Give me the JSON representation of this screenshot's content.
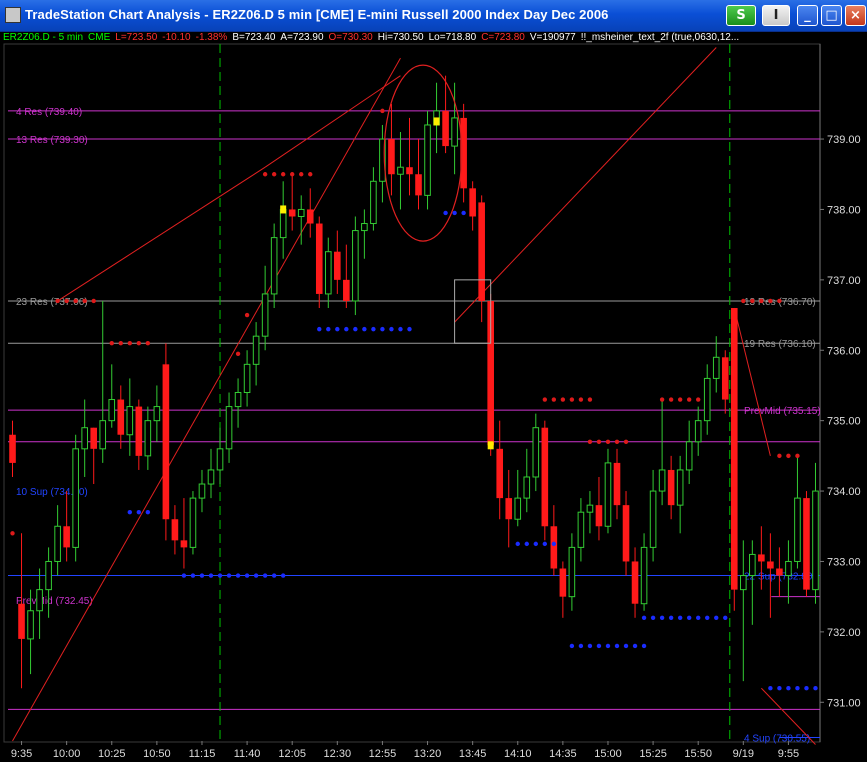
{
  "window": {
    "title": "TradeStation Chart Analysis - ER2Z06.D  5 min  [CME] E-mini Russell 2000 Index Day Dec 2006",
    "buttons": {
      "s_label": "S",
      "menu_label": "I",
      "minimize": "_",
      "maximize": "□",
      "close": "×"
    }
  },
  "status_bar": [
    {
      "text": "ER2Z06.D - 5 min",
      "color": "#00ff00"
    },
    {
      "text": "CME",
      "color": "#00ff00"
    },
    {
      "text": "L=723.50",
      "color": "#ff3030"
    },
    {
      "text": "-10.10",
      "color": "#ff3030"
    },
    {
      "text": "-1.38%",
      "color": "#ff3030"
    },
    {
      "text": "B=723.40",
      "color": "#ffffff"
    },
    {
      "text": "A=723.90",
      "color": "#ffffff"
    },
    {
      "text": "O=730.30",
      "color": "#ff3030"
    },
    {
      "text": "Hi=730.50",
      "color": "#ffffff"
    },
    {
      "text": "Lo=718.80",
      "color": "#ffffff"
    },
    {
      "text": "C=723.80",
      "color": "#ff3030"
    },
    {
      "text": "V=190977",
      "color": "#ffffff"
    },
    {
      "text": "!!_msheiner_text_2f (true,0630,12...",
      "color": "#ffffff"
    }
  ],
  "chart_data": {
    "type": "candlestick",
    "title": "ER2Z06.D 5 min",
    "ylim": [
      730.45,
      740.35
    ],
    "y_ticks": [
      731,
      732,
      733,
      734,
      735,
      736,
      737,
      738,
      739
    ],
    "y_tick_labels": [
      "731.00",
      "732.00",
      "733.00",
      "734.00",
      "735.00",
      "736.00",
      "737.00",
      "738.00",
      "739.00"
    ],
    "x_tick_labels": [
      {
        "index": 1,
        "label": "9:35"
      },
      {
        "index": 6,
        "label": "10:00"
      },
      {
        "index": 11,
        "label": "10:25"
      },
      {
        "index": 16,
        "label": "10:50"
      },
      {
        "index": 21,
        "label": "11:15"
      },
      {
        "index": 26,
        "label": "11:40"
      },
      {
        "index": 31,
        "label": "12:05"
      },
      {
        "index": 36,
        "label": "12:30"
      },
      {
        "index": 41,
        "label": "12:55"
      },
      {
        "index": 46,
        "label": "13:20"
      },
      {
        "index": 51,
        "label": "13:45"
      },
      {
        "index": 56,
        "label": "14:10"
      },
      {
        "index": 61,
        "label": "14:35"
      },
      {
        "index": 66,
        "label": "15:00"
      },
      {
        "index": 71,
        "label": "15:25"
      },
      {
        "index": 76,
        "label": "15:50"
      },
      {
        "index": 81,
        "label": "9/19"
      },
      {
        "index": 86,
        "label": "9:55"
      }
    ],
    "levels": [
      {
        "label": "4 Res (739.40)",
        "y": 739.4,
        "color": "#cc33cc",
        "dx": 0,
        "x1": 0,
        "x2": 1
      },
      {
        "label": "13 Res (739.30)",
        "y": 739.0,
        "color": "#cc33cc",
        "dx": 0,
        "x1": 0,
        "x2": 1
      },
      {
        "label": "23 Res (737.00)",
        "y": 736.7,
        "color": "#9a9a9a",
        "dx": 0,
        "x1": 0,
        "x2": 1
      },
      {
        "label": "13 Res (736.70)",
        "y": 736.7,
        "color": "#9a9a9a",
        "dx": 1,
        "x1": 0,
        "x2": 1
      },
      {
        "label": "19 Res (736.10)",
        "y": 736.1,
        "color": "#9a9a9a",
        "dx": 1,
        "x1": 0,
        "x2": 1
      },
      {
        "label": "PrevMid (735.15)",
        "y": 735.15,
        "color": "#cc33cc",
        "dx": 1,
        "x1": 0,
        "x2": 1
      },
      {
        "label": "",
        "y": 734.7,
        "color": "#cc33cc",
        "dx": 0,
        "x1": 0,
        "x2": 1
      },
      {
        "label": "10 Sup (734.00)",
        "y": 734.0,
        "color": "#2244ff",
        "dx": 0,
        "x1": 0,
        "x2": 0
      },
      {
        "label": "22 Sup (732.80)",
        "y": 732.8,
        "color": "#2244ff",
        "dx": 1,
        "x1": 0,
        "x2": 1
      },
      {
        "label": "PrevMid (732.45)",
        "y": 732.45,
        "color": "#cc33cc",
        "dx": 0,
        "x1": 0,
        "x2": 0
      },
      {
        "label": "",
        "y": 732.5,
        "color": "#cc33cc",
        "dx": 0,
        "x1": 0.94,
        "x2": 1
      },
      {
        "label": "",
        "y": 730.9,
        "color": "#cc33cc",
        "dx": 0,
        "x1": 0,
        "x2": 1
      },
      {
        "label": "4 Sup (730.55)",
        "y": 730.5,
        "color": "#2244ff",
        "dx": 1,
        "x1": 0.95,
        "x2": 1
      }
    ],
    "day_separator_index": 80,
    "session_start_index": 23,
    "resistance_dots": [
      {
        "start": 0,
        "end": 0,
        "y": 733.4
      },
      {
        "start": 5,
        "end": 9,
        "y": 736.7
      },
      {
        "start": 11,
        "end": 15,
        "y": 736.1
      },
      {
        "start": 25,
        "end": 25,
        "y": 735.95
      },
      {
        "start": 26,
        "end": 26,
        "y": 736.5
      },
      {
        "start": 28,
        "end": 33,
        "y": 738.5
      },
      {
        "start": 41,
        "end": 41,
        "y": 739.4
      },
      {
        "start": 59,
        "end": 64,
        "y": 735.3
      },
      {
        "start": 64,
        "end": 68,
        "y": 734.7
      },
      {
        "start": 72,
        "end": 76,
        "y": 735.3
      },
      {
        "start": 81,
        "end": 85,
        "y": 736.7
      },
      {
        "start": 85,
        "end": 87,
        "y": 734.5
      }
    ],
    "support_dots": [
      {
        "start": 13,
        "end": 15,
        "y": 733.7
      },
      {
        "start": 19,
        "end": 30,
        "y": 732.8
      },
      {
        "start": 34,
        "end": 44,
        "y": 736.3
      },
      {
        "start": 48,
        "end": 50,
        "y": 737.95
      },
      {
        "start": 56,
        "end": 60,
        "y": 733.25
      },
      {
        "start": 62,
        "end": 70,
        "y": 731.8
      },
      {
        "start": 70,
        "end": 79,
        "y": 732.2
      },
      {
        "start": 84,
        "end": 89,
        "y": 731.2
      }
    ],
    "markers": [
      {
        "index": 30,
        "y": 738.0,
        "color": "#ffee00"
      },
      {
        "index": 47,
        "y": 739.25,
        "color": "#ffee00"
      },
      {
        "index": 53,
        "y": 734.65,
        "color": "#ffee00"
      }
    ],
    "candles": [
      {
        "o": 734.8,
        "h": 735.0,
        "l": 734.2,
        "c": 734.4
      },
      {
        "o": 732.4,
        "h": 733.4,
        "l": 731.2,
        "c": 731.9
      },
      {
        "o": 731.9,
        "h": 732.6,
        "l": 731.4,
        "c": 732.3
      },
      {
        "o": 732.3,
        "h": 732.9,
        "l": 731.9,
        "c": 732.6
      },
      {
        "o": 732.6,
        "h": 733.2,
        "l": 732.2,
        "c": 733.0
      },
      {
        "o": 733.0,
        "h": 733.8,
        "l": 732.8,
        "c": 733.5
      },
      {
        "o": 733.5,
        "h": 734.0,
        "l": 733.0,
        "c": 733.2
      },
      {
        "o": 733.2,
        "h": 734.8,
        "l": 733.0,
        "c": 734.6
      },
      {
        "o": 734.6,
        "h": 735.3,
        "l": 734.2,
        "c": 734.9
      },
      {
        "o": 734.9,
        "h": 734.9,
        "l": 734.1,
        "c": 734.6
      },
      {
        "o": 734.6,
        "h": 736.7,
        "l": 734.4,
        "c": 735.0
      },
      {
        "o": 735.0,
        "h": 735.8,
        "l": 734.9,
        "c": 735.3
      },
      {
        "o": 735.3,
        "h": 735.5,
        "l": 734.6,
        "c": 734.8
      },
      {
        "o": 734.8,
        "h": 735.6,
        "l": 734.5,
        "c": 735.2
      },
      {
        "o": 735.2,
        "h": 735.3,
        "l": 734.3,
        "c": 734.5
      },
      {
        "o": 734.5,
        "h": 735.2,
        "l": 734.3,
        "c": 735.0
      },
      {
        "o": 735.0,
        "h": 735.5,
        "l": 734.7,
        "c": 735.2
      },
      {
        "o": 735.8,
        "h": 736.1,
        "l": 733.3,
        "c": 733.6
      },
      {
        "o": 733.6,
        "h": 733.8,
        "l": 733.1,
        "c": 733.3
      },
      {
        "o": 733.3,
        "h": 733.9,
        "l": 732.9,
        "c": 733.2
      },
      {
        "o": 733.2,
        "h": 734.0,
        "l": 733.1,
        "c": 733.9
      },
      {
        "o": 733.9,
        "h": 734.3,
        "l": 733.7,
        "c": 734.1
      },
      {
        "o": 734.1,
        "h": 734.6,
        "l": 733.9,
        "c": 734.3
      },
      {
        "o": 734.3,
        "h": 734.9,
        "l": 734.1,
        "c": 734.6
      },
      {
        "o": 734.6,
        "h": 735.4,
        "l": 734.4,
        "c": 735.2
      },
      {
        "o": 735.2,
        "h": 735.6,
        "l": 734.9,
        "c": 735.4
      },
      {
        "o": 735.4,
        "h": 736.0,
        "l": 735.2,
        "c": 735.8
      },
      {
        "o": 735.8,
        "h": 736.4,
        "l": 735.5,
        "c": 736.2
      },
      {
        "o": 736.2,
        "h": 737.2,
        "l": 736.0,
        "c": 736.8
      },
      {
        "o": 736.8,
        "h": 737.8,
        "l": 736.6,
        "c": 737.6
      },
      {
        "o": 737.6,
        "h": 738.4,
        "l": 737.3,
        "c": 738.0
      },
      {
        "o": 738.0,
        "h": 738.5,
        "l": 737.7,
        "c": 737.9
      },
      {
        "o": 737.9,
        "h": 738.2,
        "l": 737.5,
        "c": 738.0
      },
      {
        "o": 738.0,
        "h": 738.3,
        "l": 737.6,
        "c": 737.8
      },
      {
        "o": 737.8,
        "h": 737.9,
        "l": 736.6,
        "c": 736.8
      },
      {
        "o": 736.8,
        "h": 737.6,
        "l": 736.6,
        "c": 737.4
      },
      {
        "o": 737.4,
        "h": 737.7,
        "l": 736.8,
        "c": 737.0
      },
      {
        "o": 737.0,
        "h": 737.5,
        "l": 736.6,
        "c": 736.7
      },
      {
        "o": 736.7,
        "h": 737.9,
        "l": 736.5,
        "c": 737.7
      },
      {
        "o": 737.7,
        "h": 738.0,
        "l": 737.3,
        "c": 737.8
      },
      {
        "o": 737.8,
        "h": 738.6,
        "l": 737.7,
        "c": 738.4
      },
      {
        "o": 738.4,
        "h": 739.2,
        "l": 738.1,
        "c": 739.0
      },
      {
        "o": 739.0,
        "h": 739.5,
        "l": 738.2,
        "c": 738.5
      },
      {
        "o": 738.5,
        "h": 739.1,
        "l": 738.0,
        "c": 738.6
      },
      {
        "o": 738.6,
        "h": 739.3,
        "l": 738.2,
        "c": 738.5
      },
      {
        "o": 738.5,
        "h": 739.0,
        "l": 738.0,
        "c": 738.2
      },
      {
        "o": 738.2,
        "h": 739.4,
        "l": 738.0,
        "c": 739.2
      },
      {
        "o": 739.2,
        "h": 739.8,
        "l": 738.8,
        "c": 739.4
      },
      {
        "o": 739.4,
        "h": 739.9,
        "l": 738.8,
        "c": 738.9
      },
      {
        "o": 738.9,
        "h": 739.8,
        "l": 738.5,
        "c": 739.3
      },
      {
        "o": 739.3,
        "h": 739.5,
        "l": 738.1,
        "c": 738.3
      },
      {
        "o": 738.3,
        "h": 738.4,
        "l": 737.7,
        "c": 737.9
      },
      {
        "o": 738.1,
        "h": 738.2,
        "l": 736.4,
        "c": 736.7
      },
      {
        "o": 736.7,
        "h": 736.8,
        "l": 734.5,
        "c": 734.65
      },
      {
        "o": 734.6,
        "h": 735.0,
        "l": 733.6,
        "c": 733.9
      },
      {
        "o": 733.9,
        "h": 734.3,
        "l": 733.2,
        "c": 733.6
      },
      {
        "o": 733.6,
        "h": 734.3,
        "l": 733.5,
        "c": 733.9
      },
      {
        "o": 733.9,
        "h": 734.6,
        "l": 733.7,
        "c": 734.2
      },
      {
        "o": 734.2,
        "h": 735.1,
        "l": 734.0,
        "c": 734.9
      },
      {
        "o": 734.9,
        "h": 735.0,
        "l": 733.3,
        "c": 733.5
      },
      {
        "o": 733.5,
        "h": 733.8,
        "l": 732.8,
        "c": 732.9
      },
      {
        "o": 732.9,
        "h": 733.0,
        "l": 732.2,
        "c": 732.5
      },
      {
        "o": 732.5,
        "h": 733.4,
        "l": 732.3,
        "c": 733.2
      },
      {
        "o": 733.2,
        "h": 733.9,
        "l": 733.0,
        "c": 733.7
      },
      {
        "o": 733.7,
        "h": 734.0,
        "l": 733.4,
        "c": 733.8
      },
      {
        "o": 733.8,
        "h": 734.2,
        "l": 733.3,
        "c": 733.5
      },
      {
        "o": 733.5,
        "h": 734.6,
        "l": 733.4,
        "c": 734.4
      },
      {
        "o": 734.4,
        "h": 734.6,
        "l": 733.6,
        "c": 733.8
      },
      {
        "o": 733.8,
        "h": 734.0,
        "l": 732.8,
        "c": 733.0
      },
      {
        "o": 733.0,
        "h": 733.2,
        "l": 732.2,
        "c": 732.4
      },
      {
        "o": 732.4,
        "h": 733.4,
        "l": 732.3,
        "c": 733.2
      },
      {
        "o": 733.2,
        "h": 734.3,
        "l": 733.0,
        "c": 734.0
      },
      {
        "o": 734.0,
        "h": 735.3,
        "l": 733.8,
        "c": 734.3
      },
      {
        "o": 734.3,
        "h": 734.5,
        "l": 733.6,
        "c": 733.8
      },
      {
        "o": 733.8,
        "h": 734.5,
        "l": 733.4,
        "c": 734.3
      },
      {
        "o": 734.3,
        "h": 735.0,
        "l": 734.1,
        "c": 734.7
      },
      {
        "o": 734.7,
        "h": 735.2,
        "l": 734.5,
        "c": 735.0
      },
      {
        "o": 735.0,
        "h": 735.8,
        "l": 734.8,
        "c": 735.6
      },
      {
        "o": 735.6,
        "h": 736.2,
        "l": 735.4,
        "c": 735.9
      },
      {
        "o": 735.9,
        "h": 736.0,
        "l": 735.1,
        "c": 735.3
      },
      {
        "o": 736.6,
        "h": 736.6,
        "l": 732.3,
        "c": 732.6
      },
      {
        "o": 732.6,
        "h": 733.3,
        "l": 731.3,
        "c": 732.8
      },
      {
        "o": 732.8,
        "h": 733.3,
        "l": 732.1,
        "c": 733.1
      },
      {
        "o": 733.1,
        "h": 733.5,
        "l": 732.6,
        "c": 733.0
      },
      {
        "o": 733.0,
        "h": 733.4,
        "l": 732.2,
        "c": 732.9
      },
      {
        "o": 732.9,
        "h": 733.2,
        "l": 732.5,
        "c": 732.8
      },
      {
        "o": 732.8,
        "h": 733.3,
        "l": 732.4,
        "c": 733.0
      },
      {
        "o": 733.0,
        "h": 734.5,
        "l": 732.9,
        "c": 733.9
      },
      {
        "o": 733.9,
        "h": 734.0,
        "l": 732.5,
        "c": 732.6
      },
      {
        "o": 732.6,
        "h": 734.4,
        "l": 732.4,
        "c": 734.0
      }
    ],
    "trendlines": [
      {
        "i1": 0,
        "y1": 730.45,
        "i2": 43,
        "y2": 740.15
      },
      {
        "i1": 5,
        "y1": 736.7,
        "i2": 28,
        "y2": 738.6
      },
      {
        "i1": 28,
        "y1": 738.6,
        "i2": 43,
        "y2": 739.9
      },
      {
        "i1": 49,
        "y1": 736.4,
        "i2": 78,
        "y2": 740.3
      },
      {
        "i1": 80,
        "y1": 736.6,
        "i2": 84,
        "y2": 734.5
      },
      {
        "i1": 83,
        "y1": 731.2,
        "i2": 89,
        "y2": 730.4
      }
    ],
    "ellipse": {
      "cx": 45.5,
      "cy": 738.8,
      "rx": 4.3,
      "ry": 1.25
    },
    "box": {
      "i1": 49,
      "i2": 53,
      "y1": 737.0,
      "y2": 736.1
    }
  }
}
